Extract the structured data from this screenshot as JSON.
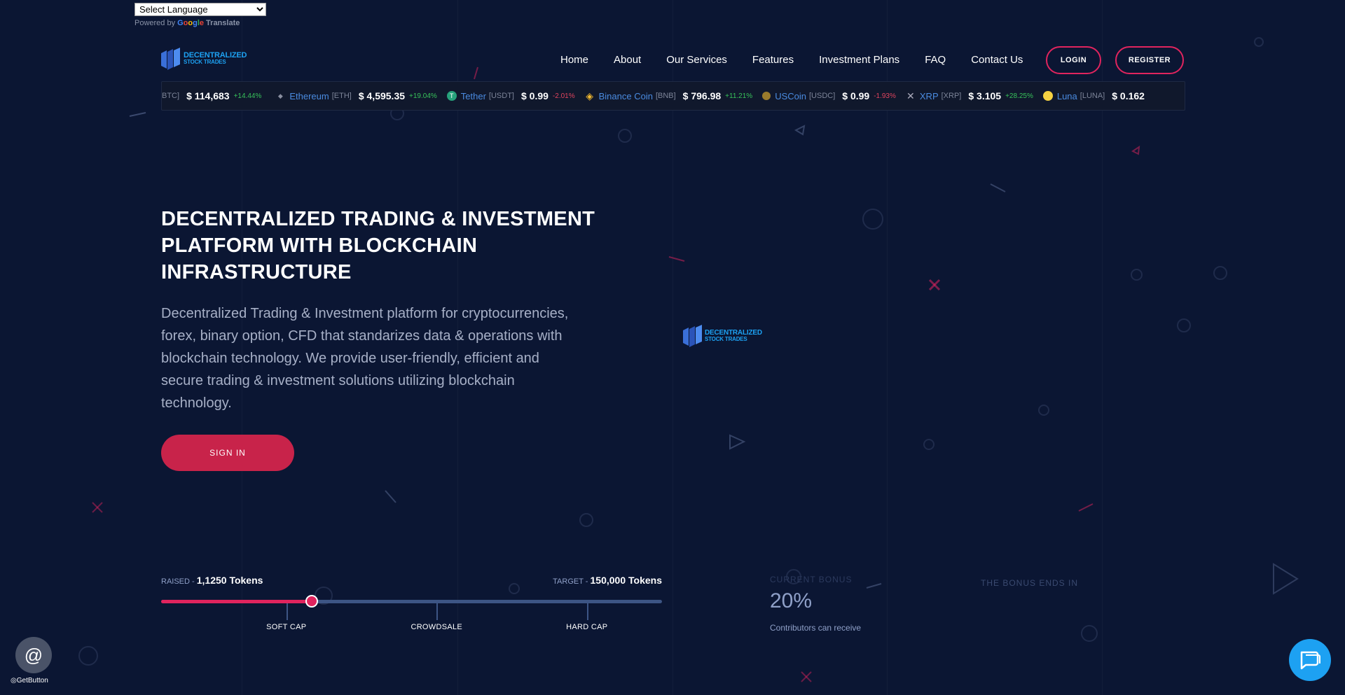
{
  "translate": {
    "select_value": "Select Language",
    "powered_by": "Powered by",
    "google": "Google",
    "translate": "Translate"
  },
  "logo": {
    "line1": "DECENTRALIZED",
    "line2": "STOCK TRADES"
  },
  "nav": {
    "items": [
      "Home",
      "About",
      "Our Services",
      "Features",
      "Investment Plans",
      "FAQ",
      "Contact Us"
    ],
    "login": "LOGIN",
    "register": "REGISTER"
  },
  "ticker": [
    {
      "name": "",
      "symbol": "BTC]",
      "price": "$ 114,683",
      "change": "+14.44%",
      "dir": "up"
    },
    {
      "name": "Ethereum",
      "symbol": "[ETH]",
      "price": "$ 4,595.35",
      "change": "+19.04%",
      "dir": "up"
    },
    {
      "name": "Tether",
      "symbol": "[USDT]",
      "price": "$ 0.99",
      "change": "-2.01%",
      "dir": "down"
    },
    {
      "name": "Binance Coin",
      "symbol": "[BNB]",
      "price": "$ 796.98",
      "change": "+11.21%",
      "dir": "up"
    },
    {
      "name": "USCoin",
      "symbol": "[USDC]",
      "price": "$ 0.99",
      "change": "-1.93%",
      "dir": "down"
    },
    {
      "name": "XRP",
      "symbol": "[XRP]",
      "price": "$ 3.105",
      "change": "+28.25%",
      "dir": "up"
    },
    {
      "name": "Luna",
      "symbol": "[LUNA]",
      "price": "$ 0.162",
      "change": "",
      "dir": "up"
    }
  ],
  "hero": {
    "title": "DECENTRALIZED TRADING & INVESTMENT PLATFORM WITH BLOCKCHAIN INFRASTRUCTURE",
    "description": "Decentralized Trading & Investment platform for cryptocurrencies, forex, binary option, CFD that standarizes data & operations with blockchain technology. We provide user-friendly, efficient and secure trading & investment solutions utilizing blockchain technology.",
    "cta": "SIGN IN"
  },
  "progress": {
    "raised_label": "RAISED - ",
    "raised_value": "1,1250 Tokens",
    "target_label": "TARGET - ",
    "target_value": "150,000 Tokens",
    "fraction": 0.3,
    "marks": [
      {
        "label": "SOFT CAP",
        "at": 0.25
      },
      {
        "label": "CROWDSALE",
        "at": 0.55
      },
      {
        "label": "HARD CAP",
        "at": 0.85
      }
    ]
  },
  "bonus": {
    "label": "CURRENT BONUS",
    "value": "20%",
    "sub": "Contributors can receive",
    "ends": "THE BONUS ENDS IN"
  },
  "getbutton": {
    "label": "GetButton"
  },
  "colors": {
    "accent": "#e0245e",
    "bg": "#0b1633",
    "link": "#4a8be0"
  }
}
